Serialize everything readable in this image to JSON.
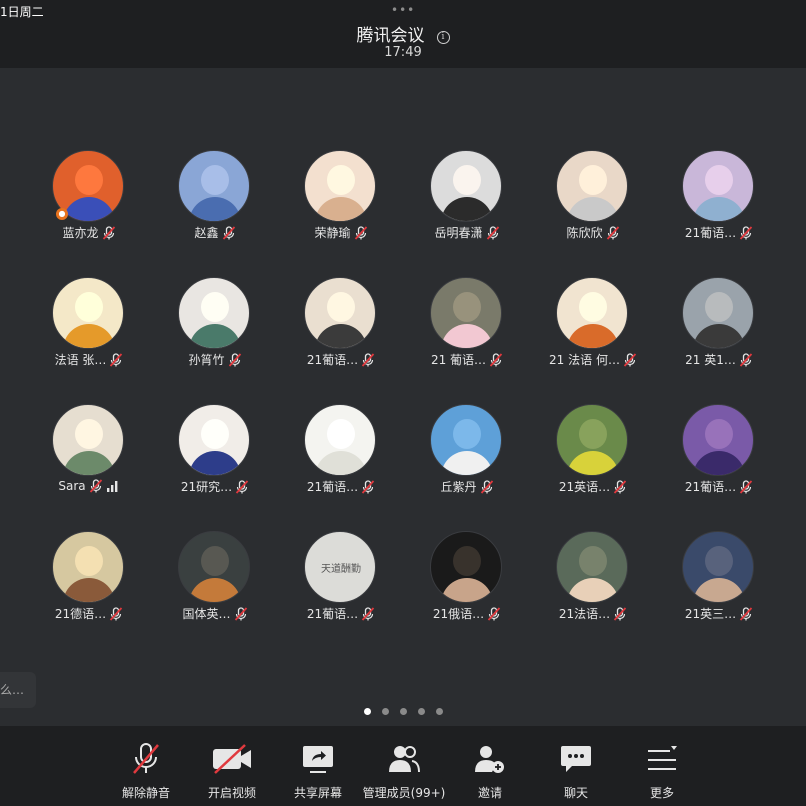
{
  "status": {
    "time": "1日周二"
  },
  "header": {
    "title": "腾讯会议",
    "clock": "17:49",
    "grab_dots": "•••"
  },
  "participants": [
    {
      "name": "蓝亦龙",
      "host": true
    },
    {
      "name": "赵鑫"
    },
    {
      "name": "荣静瑜"
    },
    {
      "name": "岳明春潇"
    },
    {
      "name": "陈欣欣"
    },
    {
      "name": "21葡语…"
    },
    {
      "name": "法语 张…"
    },
    {
      "name": "孙筲竹"
    },
    {
      "name": "21葡语…"
    },
    {
      "name": "21 葡语…"
    },
    {
      "name": "21 法语 何…"
    },
    {
      "name": "21 英1…"
    },
    {
      "name": "Sara",
      "signal": true
    },
    {
      "name": "21研究…"
    },
    {
      "name": "21葡语…"
    },
    {
      "name": "丘紫丹"
    },
    {
      "name": "21英语…"
    },
    {
      "name": "21葡语…"
    },
    {
      "name": "21德语…"
    },
    {
      "name": "国体英…"
    },
    {
      "name": "21葡语…",
      "avatar_text": "天道酬勤"
    },
    {
      "name": "21俄语…"
    },
    {
      "name": "21法语…"
    },
    {
      "name": "21英三…"
    }
  ],
  "side_tab": {
    "label": "么…"
  },
  "pager": {
    "count": 5,
    "active": 0
  },
  "toolbar": {
    "unmute": "解除静音",
    "video": "开启视频",
    "share": "共享屏幕",
    "members": "管理成员(99+)",
    "invite": "邀请",
    "chat": "聊天",
    "more": "更多"
  },
  "colors": {
    "mic_off": "#e0393e",
    "host_badge": "#e8731e",
    "signal": "#e6e6e6"
  }
}
